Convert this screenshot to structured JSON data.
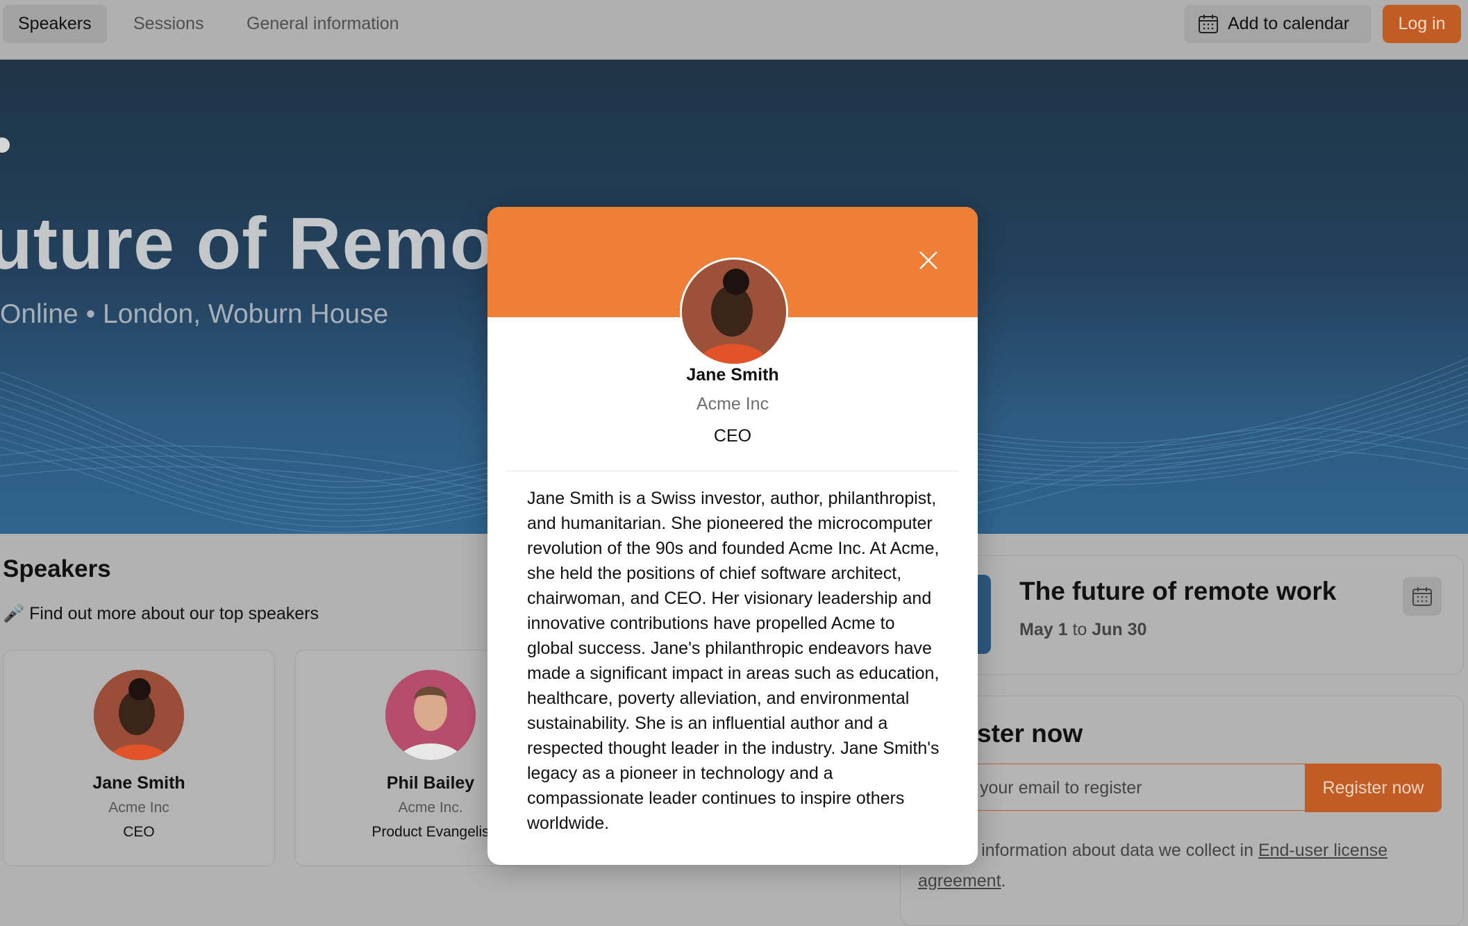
{
  "nav": {
    "tabs": [
      {
        "label": "Speakers"
      },
      {
        "label": "Sessions"
      },
      {
        "label": "General information"
      }
    ],
    "add_to_calendar_label": "Add to calendar",
    "login_label": "Log in"
  },
  "hero": {
    "title": "uture of Remot",
    "subtitle": "Online • London, Woburn House"
  },
  "speakers": {
    "heading": "Speakers",
    "description": "🎤 Find out more about our top speakers",
    "cards": [
      {
        "name": "Jane Smith",
        "company": "Acme Inc",
        "role": "CEO"
      },
      {
        "name": "Phil Bailey",
        "company": "Acme Inc.",
        "role": "Product Evangelis"
      }
    ]
  },
  "event": {
    "title": "The future of remote work",
    "date_from": "May 1",
    "date_to_word": "to",
    "date_to": "Jun 30"
  },
  "register": {
    "title": "ster now",
    "email_placeholder": "your email to register",
    "button_label": "Register now",
    "info_text": "ore information about data we collect in",
    "link_text_1": "End-user license",
    "link_text_2": "agreement",
    "info_end": "."
  },
  "modal": {
    "name": "Jane Smith",
    "company": "Acme Inc",
    "role": "CEO",
    "bio": "Jane Smith is a Swiss investor, author, philanthropist, and humanitarian. She pioneered the microcomputer revolution of the 90s and founded Acme Inc. At Acme, she held the positions of chief software architect, chairwoman, and CEO. Her visionary leadership and innovative contributions have propelled Acme to global success. Jane's philanthropic endeavors have made a significant impact in areas such as education, healthcare, poverty alleviation, and environmental sustainability. She is an influential author and a respected thought leader in the industry. Jane Smith's legacy as a pioneer in technology and a compassionate leader continues to inspire others worldwide."
  },
  "colors": {
    "accent": "#ef7e36",
    "accent_dimmed": "#c05c24",
    "hero_blue": "#2d5a80",
    "overlay_gray": "#b0b0b0"
  },
  "icons": [
    "calendar-icon",
    "close-icon",
    "microphone-emoji"
  ]
}
